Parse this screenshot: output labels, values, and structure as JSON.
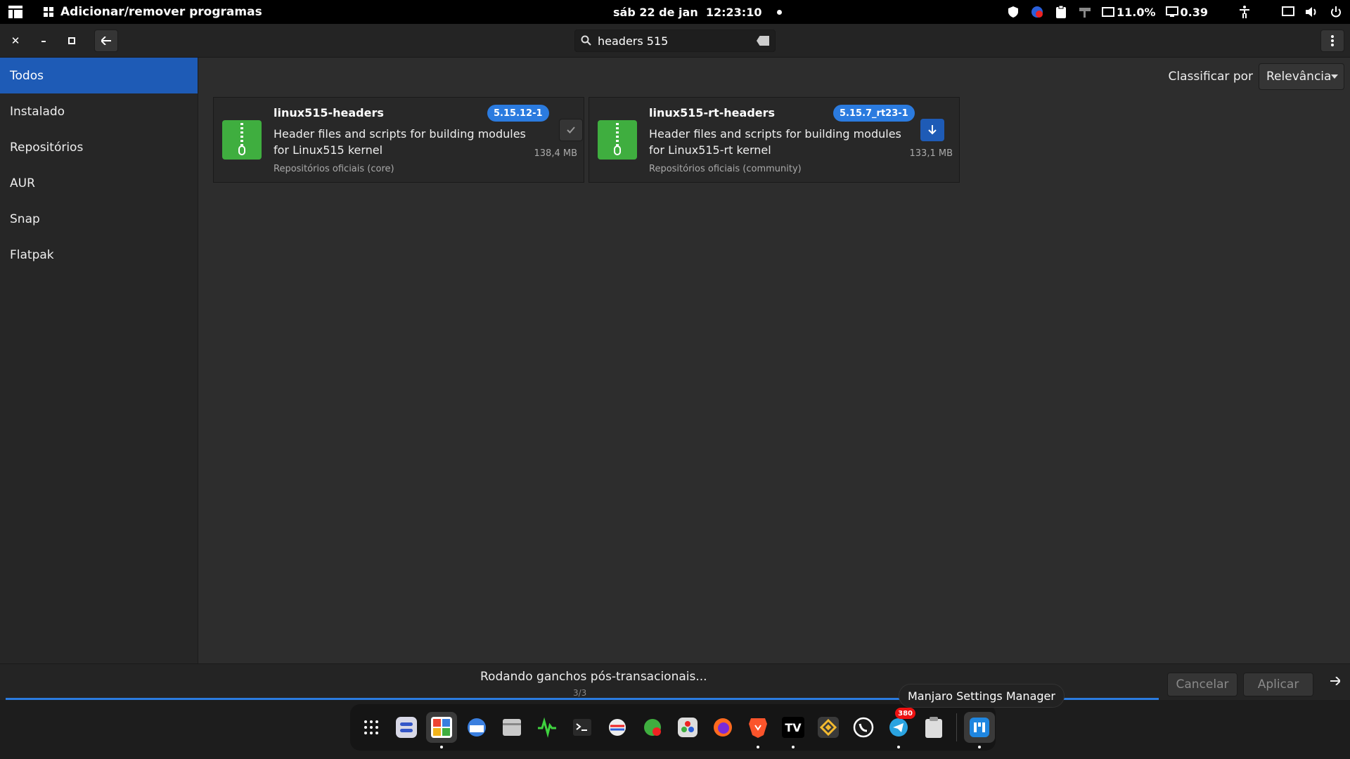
{
  "topbar": {
    "app_name": "Adicionar/remover programas",
    "date": "sáb 22 de jan",
    "time": "12:23:10",
    "cpu": "11.0%",
    "load": "0.39",
    "icons": [
      "activities-icon",
      "apps-grid-icon",
      "shield-icon",
      "update-icon",
      "clipboard-icon",
      "tweaks-icon",
      "cpu-icon",
      "display-icon",
      "accessibility-icon",
      "screen-icon",
      "volume-icon",
      "power-icon"
    ]
  },
  "headerbar": {
    "close_label": "✕",
    "minimize_label": "–",
    "maximize_label": "▫",
    "search_value": "headers 515"
  },
  "sidebar": {
    "items": [
      {
        "label": "Todos",
        "active": true
      },
      {
        "label": "Instalado",
        "active": false
      },
      {
        "label": "Repositórios",
        "active": false
      },
      {
        "label": "AUR",
        "active": false
      },
      {
        "label": "Snap",
        "active": false
      },
      {
        "label": "Flatpak",
        "active": false
      }
    ]
  },
  "main": {
    "sort_label": "Classificar por",
    "sort_value": "Relevância",
    "packages": [
      {
        "name": "linux515-headers",
        "version": "5.15.12-1",
        "desc_line1": "Header files and scripts for building modules",
        "desc_line2": "for Linux515 kernel",
        "repo": "Repositórios oficiais (core)",
        "size": "138,4 MB",
        "action": "installed",
        "icon": "package-zip-icon"
      },
      {
        "name": "linux515-rt-headers",
        "version": "5.15.7_rt23-1",
        "desc_line1": "Header files and scripts for building modules",
        "desc_line2": "for Linux515-rt kernel",
        "repo": "Repositórios oficiais (community)",
        "size": "133,1 MB",
        "action": "install",
        "icon": "package-zip-icon"
      }
    ]
  },
  "bottombar": {
    "status": "Rodando ganchos pós-transacionais...",
    "count": "3/3",
    "progress": 1.0,
    "cancel_label": "Cancelar",
    "apply_label": "Aplicar"
  },
  "tooltip": "Manjaro Settings Manager",
  "dock": {
    "telegram_badge": "380",
    "items": [
      "show-apps-icon",
      "settings-app-icon",
      "add-remove-software-icon",
      "mail-icon",
      "files-icon",
      "system-monitor-icon",
      "terminal-icon",
      "network-icon",
      "screen-recorder-icon",
      "davinci-icon",
      "firefox-icon",
      "brave-icon",
      "tradingview-icon",
      "binance-icon",
      "whatsapp-icon",
      "telegram-icon",
      "clipboard-app-icon",
      "manjaro-settings-icon"
    ]
  },
  "colors": {
    "accent": "#1e5bb6",
    "badge_blue": "#2b7bdf",
    "package_green": "#3fae3f"
  }
}
